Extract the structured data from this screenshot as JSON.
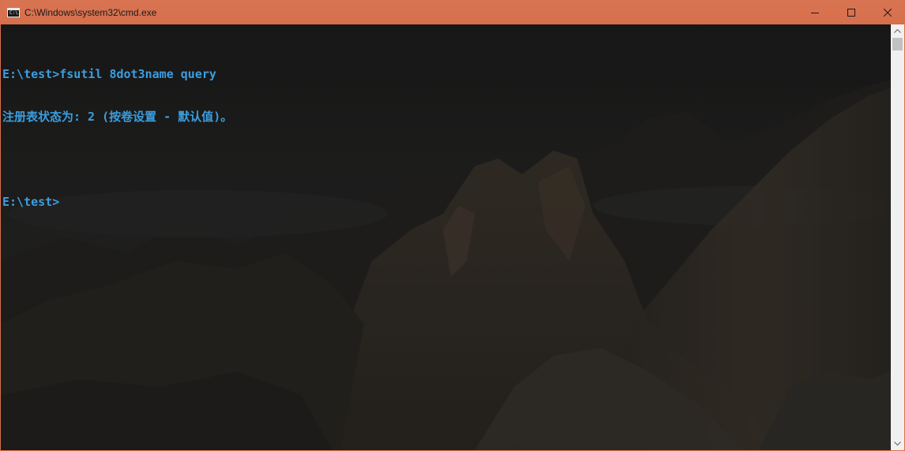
{
  "window": {
    "title": "C:\\Windows\\system32\\cmd.exe",
    "icon_text": "C:\\"
  },
  "controls": {
    "minimize_icon": "minimize-icon",
    "maximize_icon": "maximize-icon",
    "close_icon": "close-icon"
  },
  "console": {
    "lines": [
      "E:\\test>fsutil 8dot3name query",
      "注册表状态为: 2 (按卷设置 - 默认值)。",
      "",
      "E:\\test>"
    ],
    "text_color": "#3b9ede",
    "background": "dark mountain landscape wallpaper"
  },
  "colors": {
    "titlebar": "#d97452",
    "border": "#d9704f",
    "scrollbar": "#f0f0f0"
  }
}
